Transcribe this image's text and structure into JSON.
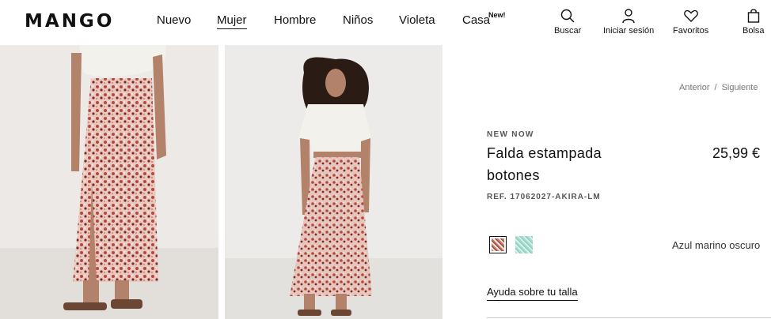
{
  "brand": {
    "logo_text": "MANGO"
  },
  "nav": {
    "items": [
      {
        "label": "Nuevo",
        "active": false
      },
      {
        "label": "Mujer",
        "active": true
      },
      {
        "label": "Hombre",
        "active": false
      },
      {
        "label": "Niños",
        "active": false
      },
      {
        "label": "Violeta",
        "active": false
      },
      {
        "label": "Casa",
        "active": false,
        "badge": "New!"
      }
    ]
  },
  "header_actions": {
    "search": {
      "label": "Buscar",
      "icon": "search-icon"
    },
    "login": {
      "label": "Iniciar sesión",
      "icon": "user-icon"
    },
    "favorites": {
      "label": "Favoritos",
      "icon": "heart-icon"
    },
    "bag": {
      "label": "Bolsa",
      "icon": "bag-icon"
    }
  },
  "breadcrumb": {
    "prev": "Anterior",
    "separator": "/",
    "next": "Siguiente"
  },
  "product": {
    "tag": "NEW NOW",
    "title": "Falda estampada botones",
    "price": "25,99 €",
    "ref": "REF. 17062027-AKIRA-LM",
    "colors": [
      {
        "name": "Azul marino oscuro",
        "selected": true,
        "hex": "#c97a6e"
      },
      {
        "name": "Verde",
        "selected": false,
        "hex": "#a8dccf"
      }
    ],
    "selected_color_label": "Azul marino oscuro",
    "size_help": "Ayuda sobre tu talla"
  },
  "colors": {
    "text": "#111111",
    "muted": "#777777",
    "background": "#ffffff"
  }
}
